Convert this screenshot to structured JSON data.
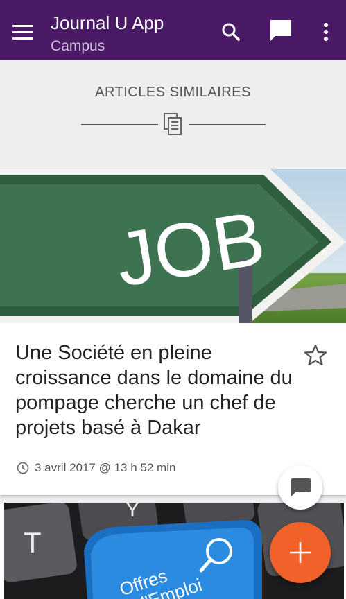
{
  "appbar": {
    "title": "Journal U App",
    "subtitle": "Campus",
    "color": "#4a1a66",
    "icons": [
      "menu-icon",
      "search-icon",
      "chat-icon",
      "more-vert-icon"
    ]
  },
  "similar": {
    "label": "ARTICLES SIMILAIRES",
    "icon": "documents-icon"
  },
  "article": {
    "image_text": "JOB",
    "title": "Une Société en pleine croissance dans le domaine du pompage cherche un chef de projets basé à Dakar",
    "date": "3 avril 2017 @ 13 h 52 min",
    "bookmark_icon": "star-outline-icon"
  },
  "next_article": {
    "image_text_1": "Offres",
    "image_text_2": "d'Emploi",
    "key_letter_1": "T",
    "key_letter_2": "Y"
  },
  "fab": {
    "comment_icon": "comment-icon",
    "add_icon": "plus-icon",
    "accent": "#f0622a"
  }
}
